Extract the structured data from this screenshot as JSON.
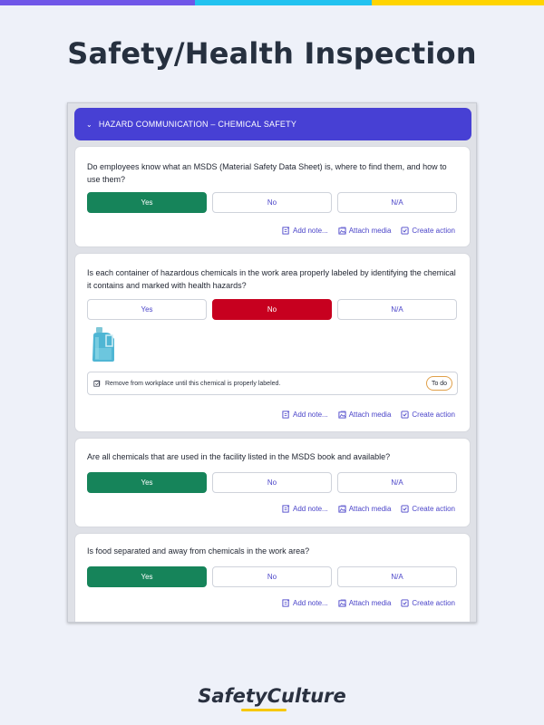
{
  "header": {
    "title": "Safety/Health Inspection"
  },
  "topbar": {
    "colors": [
      "#6f56e8",
      "#22c2f0",
      "#ffd400"
    ]
  },
  "section": {
    "title": "HAZARD COMMUNICATION – CHEMICAL SAFETY",
    "chevron_icon": "chevron-down-icon"
  },
  "response_labels": {
    "yes": "Yes",
    "no": "No",
    "na": "N/A"
  },
  "actions": {
    "add_note": "Add note...",
    "attach_media": "Attach media",
    "create_action": "Create action"
  },
  "questions": [
    {
      "text": "Do employees know what an MSDS (Material Safety Data Sheet) is, where to find them, and how to use them?",
      "selected": "Yes"
    },
    {
      "text": "Is each container of hazardous chemicals in the work area properly labeled by identifying the chemical it contains and marked with health hazards?",
      "selected": "No",
      "media": "chemical-bottle-photo",
      "action_note": "Remove from workplace until this chemical is properly labeled.",
      "action_status": "To do"
    },
    {
      "text": "Are all chemicals that are used in the facility listed in the MSDS book and available?",
      "selected": "Yes"
    },
    {
      "text": "Is food separated and away from chemicals in the work area?",
      "selected": "Yes"
    }
  ],
  "colors": {
    "accent": "#4740d4",
    "yes": "#16845a",
    "no": "#c7001f",
    "link": "#4b45c9"
  },
  "brand": {
    "name": "SafetyCulture"
  }
}
